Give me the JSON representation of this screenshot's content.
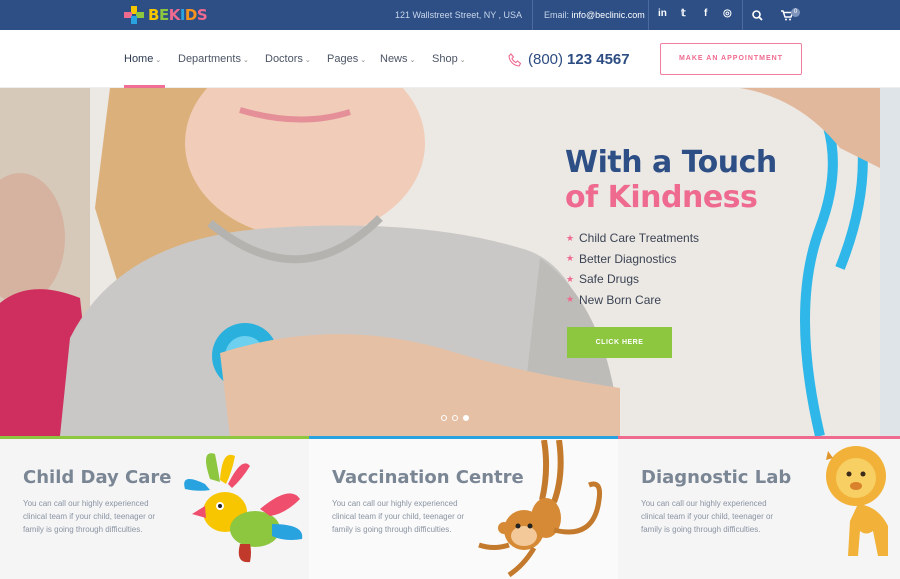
{
  "brand": {
    "name": "BEKIDS",
    "letters": [
      "B",
      "E",
      "K",
      "I",
      "D",
      "S"
    ],
    "letter_colors": [
      "#f7c600",
      "#8dc63f",
      "#ef6a8f",
      "#29a3e0",
      "#f7941d",
      "#ef6a8f"
    ]
  },
  "topbar": {
    "address": "121 Wallstreet Street, NY , USA",
    "email_label": "Email:",
    "email": "info@beclinic.com",
    "social": [
      "in",
      "𝕥",
      "f",
      "◎"
    ],
    "cart_count": "0"
  },
  "nav": {
    "items": [
      {
        "label": "Home",
        "active": true
      },
      {
        "label": "Departments"
      },
      {
        "label": "Doctors"
      },
      {
        "label": "Pages"
      },
      {
        "label": "News"
      },
      {
        "label": "Shop"
      }
    ],
    "phone_prefix": "(800)",
    "phone_number": "123 4567",
    "appointment_label": "MAKE AN APPOINTMENT"
  },
  "hero": {
    "title_line1": "With a Touch",
    "title_line2": "of Kindness",
    "features": [
      "Child Care Treatments",
      "Better Diagnostics",
      "Safe Drugs",
      "New Born Care"
    ],
    "cta_label": "CLICK HERE",
    "slides": 3,
    "active_slide": 2
  },
  "services": [
    {
      "title": "Child Day Care",
      "text": "You can call our highly experienced clinical team if your child, teenager or family is going through difficulties.",
      "accent": "#8dc63f",
      "icon": "parrot-icon"
    },
    {
      "title": "Vaccination Centre",
      "text": "You can call our highly experienced clinical team if your child, teenager or family is going through difficulties.",
      "accent": "#29a3e0",
      "icon": "monkey-icon"
    },
    {
      "title": "Diagnostic Lab",
      "text": "You can call our highly experienced clinical team if your child, teenager or family is going through difficulties.",
      "accent": "#ef6a8f",
      "icon": "lion-icon"
    }
  ],
  "colors": {
    "navy": "#2d4f86",
    "pink": "#ef6a8f",
    "green": "#8dc63f",
    "blue": "#29a3e0"
  }
}
